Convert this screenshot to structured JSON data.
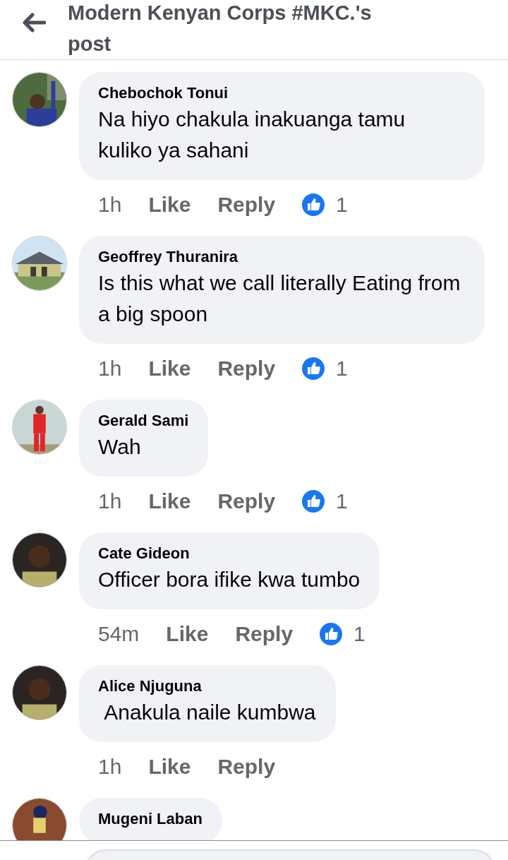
{
  "header": {
    "title": "Modern Kenyan Corps #MKC.'s post"
  },
  "comments": [
    {
      "author": "Chebochok Tonui",
      "text": "Na hiyo chakula inakuanga tamu kuliko ya sahani",
      "time": "1h",
      "like": "Like",
      "reply": "Reply",
      "reactions": "1"
    },
    {
      "author": "Geoffrey Thuranira",
      "text": "Is this what we call literally Eating from  a big spoon",
      "time": "1h",
      "like": "Like",
      "reply": "Reply",
      "reactions": "1"
    },
    {
      "author": "Gerald Sami",
      "text": "Wah",
      "time": "1h",
      "like": "Like",
      "reply": "Reply",
      "reactions": "1"
    },
    {
      "author": "Cate Gideon",
      "text": "Officer bora ifike kwa tumbo",
      "time": "54m",
      "like": "Like",
      "reply": "Reply",
      "reactions": "1"
    },
    {
      "author": "Alice Njuguna",
      "text": " Anakula naile kumbwa",
      "time": "1h",
      "like": "Like",
      "reply": "Reply"
    },
    {
      "author": "Mugeni Laban"
    }
  ]
}
